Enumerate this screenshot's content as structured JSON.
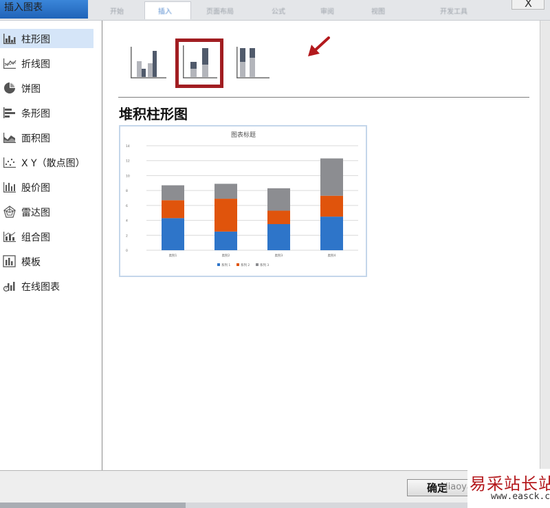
{
  "dialog": {
    "title": "插入图表",
    "ribbon_tabs": [
      "开始",
      "插入",
      "页面布局",
      "公式",
      "审阅",
      "视图",
      "开发工具"
    ],
    "close_glyph": "X"
  },
  "sidebar": {
    "items": [
      {
        "label": "柱形图",
        "icon": "column-chart-icon",
        "selected": true
      },
      {
        "label": "折线图",
        "icon": "line-chart-icon"
      },
      {
        "label": "饼图",
        "icon": "pie-chart-icon"
      },
      {
        "label": "条形图",
        "icon": "bar-chart-icon"
      },
      {
        "label": "面积图",
        "icon": "area-chart-icon"
      },
      {
        "label": "X Y（散点图）",
        "icon": "scatter-chart-icon"
      },
      {
        "label": "股价图",
        "icon": "stock-chart-icon"
      },
      {
        "label": "雷达图",
        "icon": "radar-chart-icon"
      },
      {
        "label": "组合图",
        "icon": "combo-chart-icon"
      },
      {
        "label": "模板",
        "icon": "template-icon"
      },
      {
        "label": "在线图表",
        "icon": "online-chart-icon"
      }
    ]
  },
  "chart_types": {
    "options": [
      "clustered-column-icon",
      "stacked-column-icon",
      "percent-stacked-column-icon"
    ],
    "selected_index": 1,
    "subtype_title": "堆积柱形图"
  },
  "colors": {
    "accent_red": "#a11d21",
    "series_blue": "#2e75c9",
    "series_orange": "#e0540c",
    "series_gray": "#8c8d91",
    "selected_item_bg": "#d5e5f8"
  },
  "chart_data": {
    "type": "bar",
    "stacked": true,
    "title": "图表标题",
    "categories": [
      "类别1",
      "类别2",
      "类别3",
      "类别4"
    ],
    "series": [
      {
        "name": "系列 1",
        "values": [
          4.3,
          2.5,
          3.5,
          4.5
        ]
      },
      {
        "name": "系列 2",
        "values": [
          2.4,
          4.4,
          1.8,
          2.8
        ]
      },
      {
        "name": "系列 3",
        "values": [
          2,
          2,
          3,
          5
        ]
      }
    ],
    "ylim": [
      0,
      14
    ],
    "yticks": [
      "0",
      "2",
      "4",
      "6",
      "8",
      "10",
      "12",
      "14"
    ],
    "grid": true,
    "legend": "bottom"
  },
  "footer": {
    "ok_label": "确定",
    "ok_overlay": "jiaoyan.l"
  },
  "watermark": {
    "text": "易采站长站",
    "url": "www.easck.com"
  }
}
